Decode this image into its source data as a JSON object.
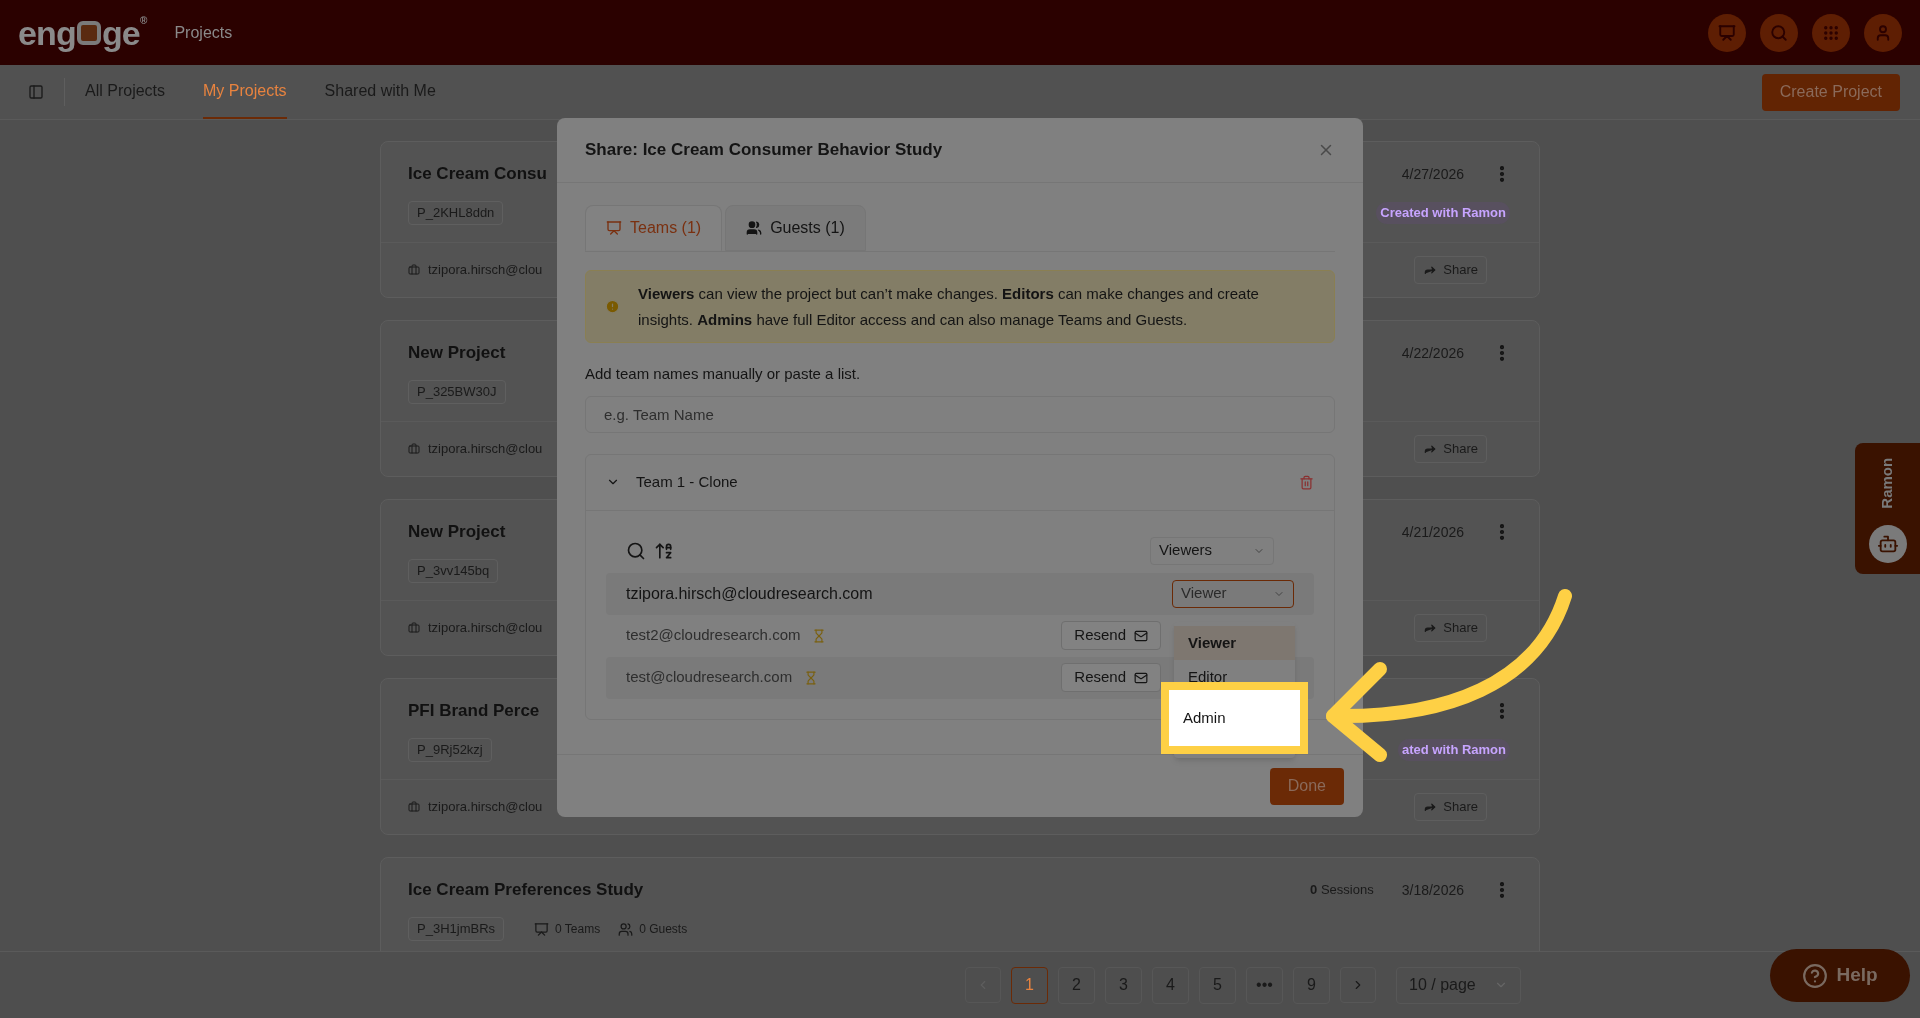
{
  "header": {
    "logo": {
      "start": "eng",
      "end": "ge",
      "mark": "®"
    },
    "app_title": "Projects"
  },
  "nav": {
    "tabs": [
      {
        "label": "All Projects",
        "selected": false
      },
      {
        "label": "My Projects",
        "selected": true
      },
      {
        "label": "Shared with Me",
        "selected": false
      }
    ],
    "create_button": "Create Project"
  },
  "projects": [
    {
      "title": "Ice Cream Consu",
      "id": "P_2KHL8ddn",
      "owner": "tzipora.hirsch@clou",
      "date": "4/27/2026",
      "tag": "Created with Ramon",
      "share": "Share"
    },
    {
      "title": "New Project",
      "id": "P_325BW30J",
      "owner": "tzipora.hirsch@clou",
      "date": "4/22/2026",
      "share": "Share"
    },
    {
      "title": "New Project",
      "id": "P_3vv145bq",
      "owner": "tzipora.hirsch@clou",
      "date": "4/21/2026",
      "share": "Share"
    },
    {
      "title": "PFI Brand Perce",
      "id": "P_9Rj52kzj",
      "owner": "tzipora.hirsch@clou",
      "tag": "ated with Ramon",
      "share": "Share"
    },
    {
      "title": "Ice Cream Preferences Study",
      "id": "P_3H1jmBRs",
      "teams": "0 Teams",
      "guests": "0 Guests",
      "sessions_count": "0",
      "sessions_label": "Sessions",
      "date": "3/18/2026"
    }
  ],
  "modal": {
    "title": "Share: Ice Cream Consumer Behavior Study",
    "tabs": [
      {
        "label": "Teams (1)",
        "kind": "teams",
        "selected": true
      },
      {
        "label": "Guests (1)",
        "kind": "guests",
        "selected": false
      }
    ],
    "info": "**Viewers** can view the project but can’t make changes. **Editors** can make changes and create insights. **Admins** have full Editor access and can also manage Teams and Guests.",
    "input_label": "Add team names manually or paste a list.",
    "input_placeholder": "e.g. Team Name",
    "team": {
      "name": "Team 1 - Clone",
      "expanded": true,
      "role_filter": "Viewers",
      "members": [
        {
          "email": "tzipora.hirsch@cloudresearch.com",
          "pending": false,
          "role": "Viewer"
        },
        {
          "email": "test2@cloudresearch.com",
          "pending": true,
          "resend": "Resend"
        },
        {
          "email": "test@cloudresearch.com",
          "pending": true,
          "resend": "Resend"
        }
      ],
      "role_options": [
        {
          "label": "Viewer",
          "selected": true,
          "spotlight": false
        },
        {
          "label": "Editor",
          "selected": false,
          "spotlight": false
        },
        {
          "label": "Admin",
          "selected": false,
          "spotlight": true
        }
      ]
    },
    "done": "Done"
  },
  "pagination": {
    "pages": [
      {
        "label": "1",
        "selected": true
      },
      {
        "label": "2",
        "selected": false
      },
      {
        "label": "3",
        "selected": false
      },
      {
        "label": "4",
        "selected": false
      },
      {
        "label": "5",
        "selected": false
      },
      {
        "label": "•••",
        "selected": false
      },
      {
        "label": "9",
        "selected": false
      }
    ],
    "page_size": "10 / page"
  },
  "side_tab": "Ramon",
  "help": "Help"
}
